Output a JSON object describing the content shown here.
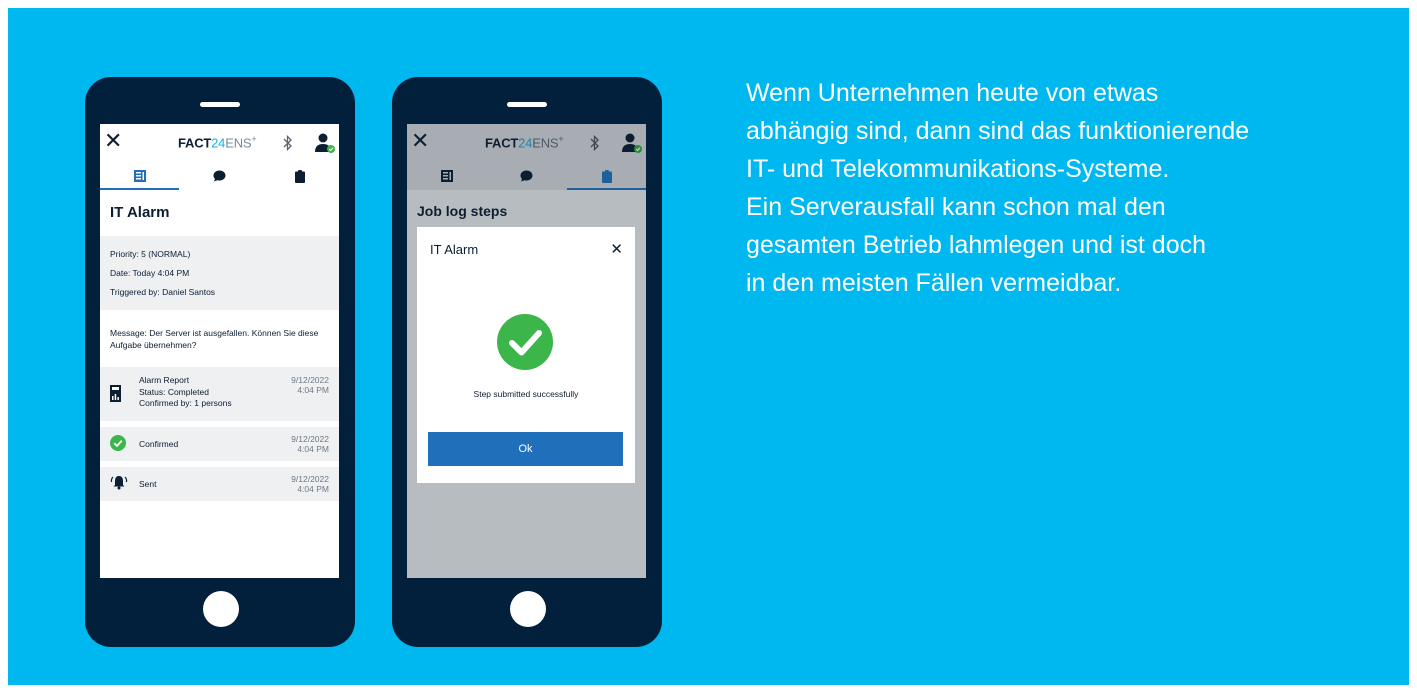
{
  "phone1": {
    "app_title": {
      "part1": "FACT",
      "part2": "24",
      "part3": "ENS",
      "plus": "+"
    },
    "title": "IT Alarm",
    "info": {
      "priority": "Priority: 5 (NORMAL)",
      "date": "Date: Today 4:04 PM",
      "triggered": "Triggered by: Daniel Santos"
    },
    "message": "Message: Der Server ist ausgefallen. Können Sie diese Aufgabe übernehmen?",
    "entries": [
      {
        "icon": "report-icon",
        "lines": [
          "Alarm Report",
          "Status: Completed",
          "Confirmed by: 1 persons"
        ],
        "date": "9/12/2022",
        "time": "4:04 PM"
      },
      {
        "icon": "check-circle-icon",
        "label": "Confirmed",
        "date": "9/12/2022",
        "time": "4:04 PM"
      },
      {
        "icon": "alarm-bell-icon",
        "label": "Sent",
        "date": "9/12/2022",
        "time": "4:04 PM"
      }
    ]
  },
  "phone2": {
    "app_title": {
      "part1": "FACT",
      "part2": "24",
      "part3": "ENS",
      "plus": "+"
    },
    "page_title": "Job log steps",
    "dialog": {
      "title": "IT Alarm",
      "message": "Step submitted successfully",
      "button": "Ok"
    }
  },
  "copy": {
    "lines": [
      "Wenn Unternehmen heute von etwas",
      "abhängig sind, dann sind das funktionierende",
      "IT- und Telekommunikations-Systeme.",
      "Ein Serverausfall kann schon mal den",
      "gesamten Betrieb lahmlegen und ist doch",
      "in den meisten Fällen vermeidbar."
    ]
  },
  "colors": {
    "background": "#00b8f0",
    "phone_body": "#02203c",
    "accent": "#1f6fba",
    "success": "#3cb54a",
    "brand_cyan": "#1ab1e6"
  }
}
